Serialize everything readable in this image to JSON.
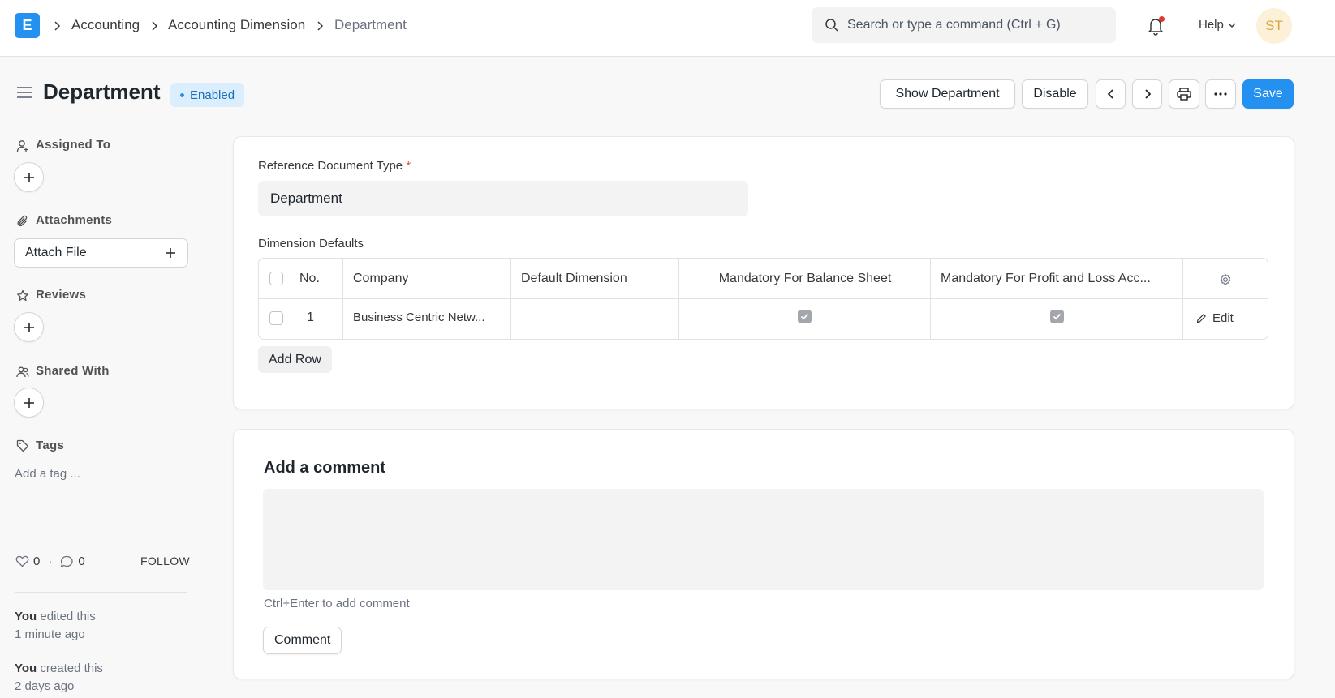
{
  "navbar": {
    "logo_letter": "E",
    "breadcrumbs": [
      "Accounting",
      "Accounting Dimension",
      "Department"
    ],
    "search_placeholder": "Search or type a command (Ctrl + G)",
    "help_label": "Help",
    "avatar_initials": "ST"
  },
  "page": {
    "title": "Department",
    "status": "Enabled",
    "buttons": {
      "show": "Show Department",
      "disable": "Disable",
      "save": "Save"
    }
  },
  "sidebar": {
    "assigned_to": "Assigned To",
    "attachments": "Attachments",
    "attach_file": "Attach File",
    "reviews": "Reviews",
    "shared_with": "Shared With",
    "tags": "Tags",
    "add_tag": "Add a tag ...",
    "likes": "0",
    "comments": "0",
    "follow": "FOLLOW",
    "activity": [
      {
        "actor": "You",
        "action": " edited this",
        "time": "1 minute ago"
      },
      {
        "actor": "You",
        "action": " created this",
        "time": "2 days ago"
      }
    ]
  },
  "form": {
    "ref_doc_type_label": "Reference Document Type",
    "ref_doc_type_value": "Department",
    "dimension_defaults_label": "Dimension Defaults",
    "table": {
      "columns": [
        "No.",
        "Company",
        "Default Dimension",
        "Mandatory For Balance Sheet",
        "Mandatory For Profit and Loss Acc..."
      ],
      "rows": [
        {
          "no": "1",
          "company": "Business Centric Netw...",
          "default_dimension": "",
          "mandatory_bs": true,
          "mandatory_pl": true,
          "edit": "Edit"
        }
      ]
    },
    "add_row": "Add Row"
  },
  "comment": {
    "title": "Add a comment",
    "hint": "Ctrl+Enter to add comment",
    "button": "Comment"
  },
  "colors": {
    "primary": "#2490ef",
    "indicator_bg": "#dbeefe",
    "indicator_text": "#1a6fb8"
  }
}
